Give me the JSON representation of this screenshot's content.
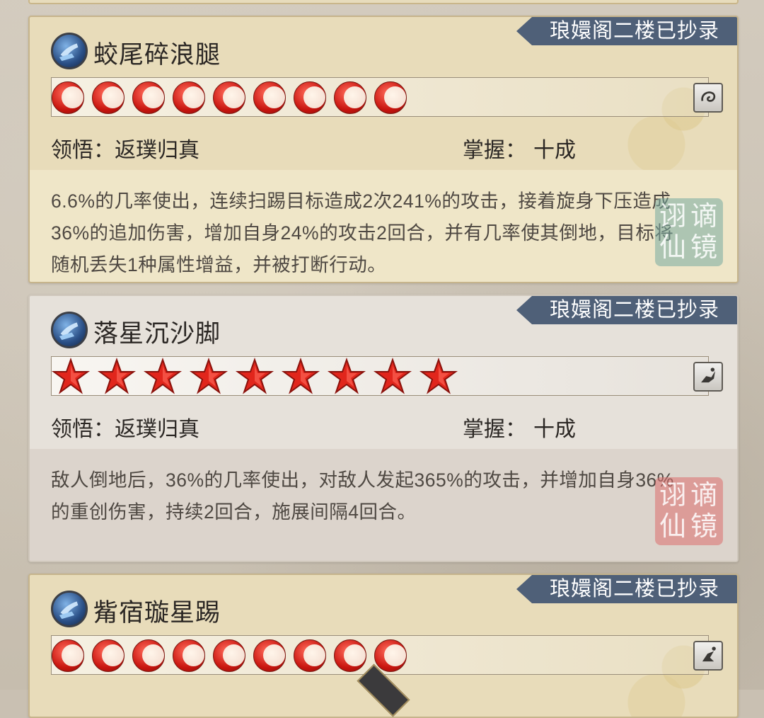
{
  "ribbon_text": "琅嬛阁二楼已抄录",
  "labels": {
    "comprehension": "领悟：",
    "mastery": "掌握："
  },
  "colors": {
    "ribbon": "#4f6078",
    "pip_red": "#d0211a"
  },
  "cards": [
    {
      "name": "蛟尾碎浪腿",
      "pip_style": "moon",
      "pip_count": 9,
      "comprehension": "返璞归真",
      "mastery": "十成",
      "description": "6.6%的几率使出，连续扫踢目标造成2次241%的攻击，接着旋身下压造成36%的追加伤害，增加自身24%的攻击2回合，并有几率使其倒地，目标将随机丢失1种属性增益，并被打断行动。",
      "seal": "谪仙",
      "skill_icon": "kick-skill-icon",
      "mini_icon": "swirl-mini-icon"
    },
    {
      "name": "落星沉沙脚",
      "pip_style": "star",
      "pip_count": 9,
      "comprehension": "返璞归真",
      "mastery": "十成",
      "description": "敌人倒地后，36%的几率使出，对敌人发起365%的攻击，并增加自身36%的重创伤害，持续2回合，施展间隔4回合。",
      "seal": "谪仙",
      "skill_icon": "kick-skill-icon",
      "mini_icon": "fighter-mini-icon"
    },
    {
      "name": "觜宿璇星踢",
      "pip_style": "moon",
      "pip_count": 9,
      "skill_icon": "kick-skill-icon",
      "mini_icon": "leap-mini-icon"
    }
  ]
}
